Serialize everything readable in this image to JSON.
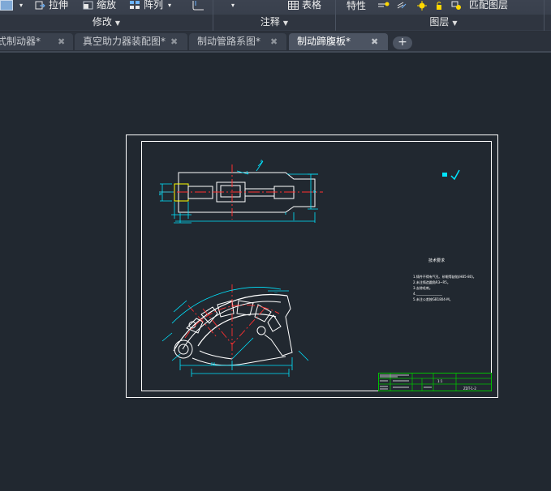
{
  "ribbon": {
    "modify": {
      "stretch_label": "拉伸",
      "scale_label": "缩放",
      "array_label": "阵列",
      "panel_label": "修改"
    },
    "annotation": {
      "table_label": "表格",
      "panel_label": "注释"
    },
    "layers": {
      "properties_label": "特性",
      "match_layer_label": "匹配图层",
      "panel_label": "图层"
    }
  },
  "tabs": [
    {
      "label": "式制动器*"
    },
    {
      "label": "真空助力器装配图*"
    },
    {
      "label": "制动管路系图*"
    },
    {
      "label": "制动蹄腹板*",
      "active": true
    }
  ],
  "drawing": {
    "notes_title": "技术要求",
    "notes": [
      "1.铸件不得有气孔、砂眼等缺陷(HB5-80)。",
      "2.未注铸造圆角R3~R5。",
      "3.去除毛刺。",
      "4.________________",
      "5.未注公差按GB1804-M。"
    ],
    "title_block": {
      "scale": "1:1",
      "code": "ZDT-1-2"
    },
    "dim_text": "R8"
  },
  "colors": {
    "canvas": "#212830",
    "sheet_frame": "#ffffff",
    "geometry": "#ffffff",
    "dimension": "#00e5ff",
    "centerline": "#ff3030",
    "title_block": "#00c000",
    "accent": "#ffd800"
  }
}
